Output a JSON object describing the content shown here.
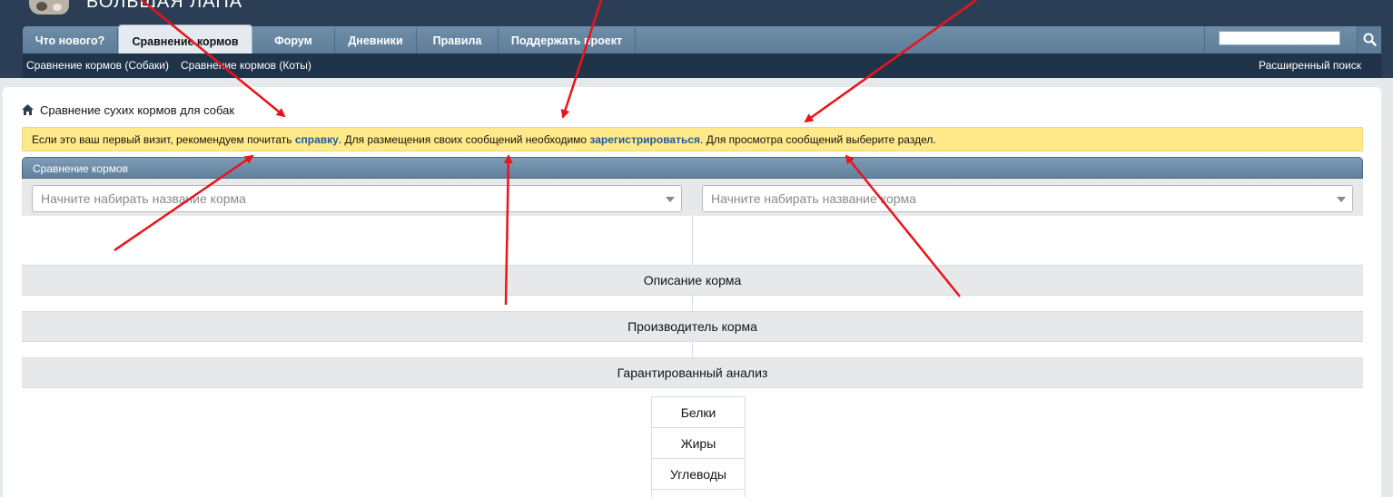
{
  "site": {
    "logo_text": "БОЛЬШАЯ ЛАПА"
  },
  "nav": {
    "tabs": [
      {
        "label": "Что нового?"
      },
      {
        "label": "Сравнение кормов"
      },
      {
        "label": "Форум"
      },
      {
        "label": "Дневники"
      },
      {
        "label": "Правила"
      },
      {
        "label": "Поддержать проект"
      }
    ],
    "active_tab": "Сравнение кормов",
    "search_value": ""
  },
  "subnav": {
    "links": [
      {
        "label": "Сравнение кормов (Собаки)"
      },
      {
        "label": "Сравнение кормов (Коты)"
      }
    ],
    "advanced_search": "Расширенный поиск"
  },
  "breadcrumb": {
    "title": "Сравнение сухих кормов для собак"
  },
  "notice": {
    "text_1": "Если это ваш первый визит, рекомендуем почитать ",
    "link_1": "справку",
    "text_2": ". Для размещения своих сообщений необходимо ",
    "link_2": "зарегистрироваться",
    "text_3": ". Для просмотра сообщений выберите раздел."
  },
  "comparison": {
    "header": "Сравнение кормов",
    "select_left_placeholder": "Начните набирать название корма",
    "select_right_placeholder": "Начните набирать название корма",
    "sections": [
      "Описание корма",
      "Производитель корма",
      "Гарантированный анализ"
    ],
    "nutrients": [
      "Белки",
      "Жиры",
      "Углеводы"
    ]
  },
  "colors": {
    "header_bg": "#2c3e55",
    "notice_bg": "#ffe98a",
    "link": "#1f5d96",
    "annotation_arrow": "#e8141a"
  }
}
